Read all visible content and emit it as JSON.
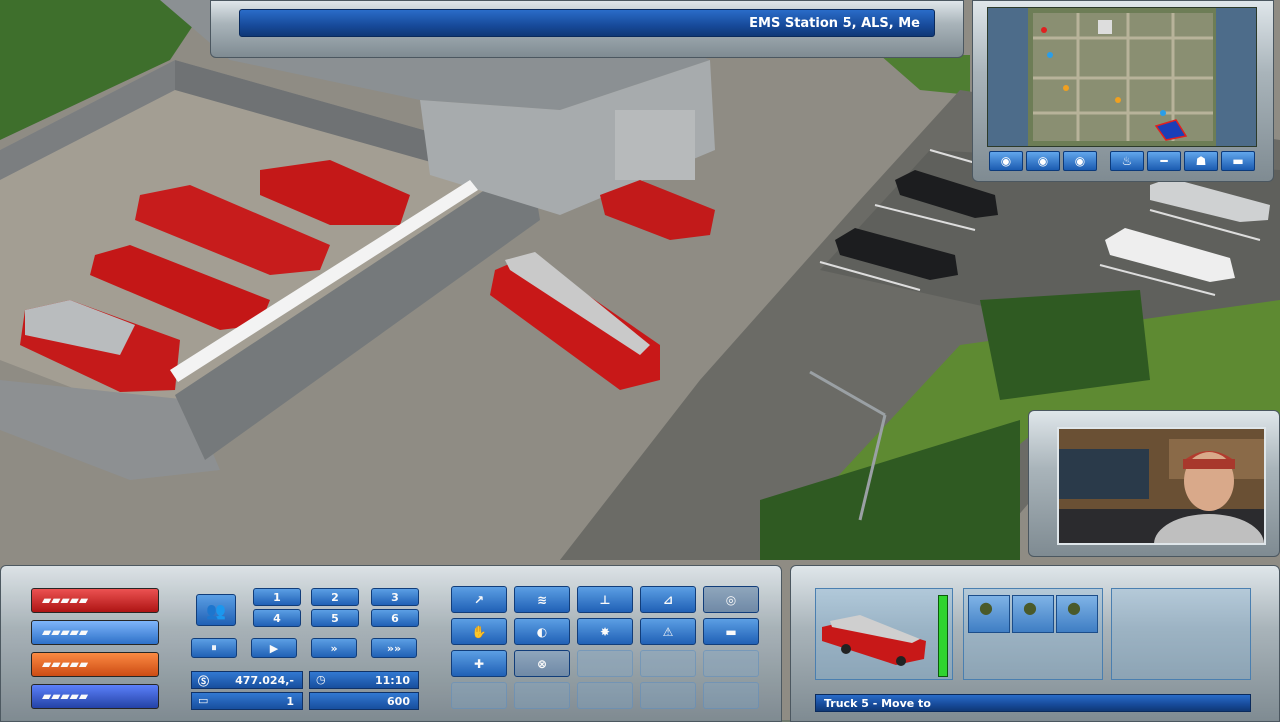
{
  "top_bar": {
    "location_text": "EMS Station 5, ALS, Me"
  },
  "minimap": {
    "buttons": [
      {
        "icon": "eye-icon"
      },
      {
        "icon": "eye-icon"
      },
      {
        "icon": "eye-icon"
      },
      {
        "icon": "fire-icon"
      },
      {
        "icon": "hose-icon"
      },
      {
        "icon": "person-icon"
      },
      {
        "icon": "ambulance-icon"
      }
    ]
  },
  "left_panel": {
    "vehicle_tabs": [
      {
        "icon": "fire-truck-tab-icon",
        "color": "#c81818"
      },
      {
        "icon": "police-car-tab-icon",
        "color": "#3b7fd8"
      },
      {
        "icon": "ambulance-tab-icon",
        "color": "#e6551c"
      },
      {
        "icon": "tech-vehicle-tab-icon",
        "color": "#2e4fb0"
      }
    ],
    "group_buttons": [
      "1",
      "2",
      "3",
      "4",
      "5",
      "6"
    ],
    "speed_buttons": [
      "⏸",
      "▶",
      "»",
      "»»"
    ],
    "money": "477.024,-",
    "clock": "11:10",
    "units_count": "1",
    "score": "600"
  },
  "action_panel": {
    "buttons": [
      {
        "icon": "move-arrow-icon"
      },
      {
        "icon": "hose-spray-icon"
      },
      {
        "icon": "hydrant-connect-icon"
      },
      {
        "icon": "ladder-icon"
      },
      {
        "icon": "disabled-slot-icon"
      },
      {
        "icon": "grab-hand-icon"
      },
      {
        "icon": "siren-icon"
      },
      {
        "icon": "light-icon"
      },
      {
        "icon": "warning-cone-icon"
      },
      {
        "icon": "bar-icon"
      },
      {
        "icon": "hydrant-plus-icon"
      },
      {
        "icon": "cancel-circle-icon"
      }
    ]
  },
  "selection_panel": {
    "selected_unit_status": "Truck 5 - Move to",
    "crew_slots": 3
  },
  "colors": {
    "hud_blue": "#1c5fb8",
    "hud_metal": "#a9b4ba",
    "fire_red": "#c81818"
  }
}
